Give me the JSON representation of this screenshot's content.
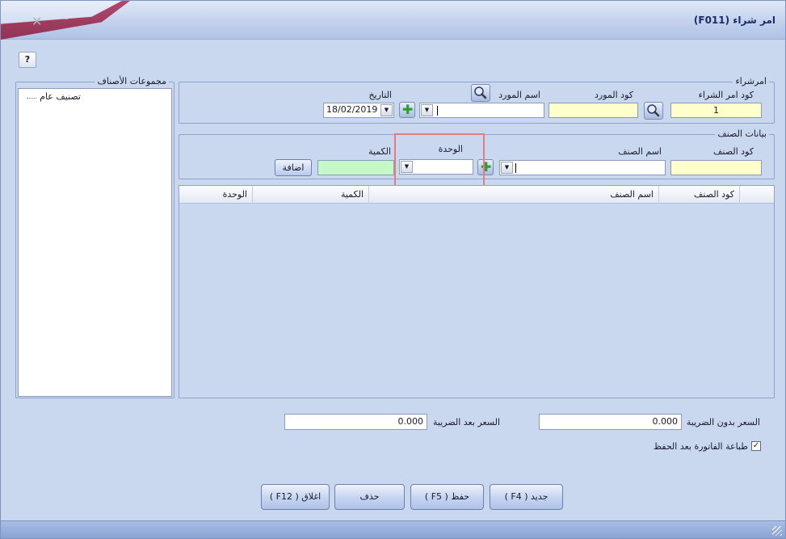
{
  "window": {
    "title": "امر شراء  (F011)"
  },
  "help": {
    "label": "?"
  },
  "purchase_order": {
    "legend": "امرشراء",
    "order_code_label": "كود امر الشراء",
    "order_code_value": "1",
    "supplier_code_label": "كود المورد",
    "supplier_code_value": "",
    "supplier_name_label": "اسم المورد",
    "supplier_name_value": "",
    "date_label": "التاريخ",
    "date_value": "18/02/2019"
  },
  "item_data": {
    "legend": "بيانات الصنف",
    "item_code_label": "كود الصنف",
    "item_code_value": "",
    "item_name_label": "اسم الصنف",
    "item_name_value": "",
    "unit_label": "الوحدة",
    "unit_value": "",
    "quantity_label": "الكمية",
    "quantity_value": "",
    "add_label": "اضافة"
  },
  "categories": {
    "legend": "مجموعات الأصناف",
    "root": "تصنيف عام"
  },
  "grid": {
    "columns": [
      "كود الصنف",
      "اسم الصنف",
      "الكمية",
      "الوحدة"
    ],
    "rows": []
  },
  "totals": {
    "price_before_tax_label": "السعر بدون الضريبة",
    "price_before_tax_value": "0.000",
    "price_after_tax_label": "السعر بعد الضريبة",
    "price_after_tax_value": "0.000",
    "print_after_save_label": "طباعة الفاتورة بعد الحفظ",
    "print_after_save_checked": true
  },
  "buttons": {
    "new": "جديد ( F4 )",
    "save": "حفظ ( F5 )",
    "delete": "حذف",
    "close": "اغلاق ( F12 )"
  },
  "icons": {
    "search": "search-icon",
    "add": "plus-icon",
    "dropdown": "chevron-down-icon"
  },
  "colors": {
    "window_bg": "#c9d7ef",
    "required_field": "#ffffcc",
    "quantity_field": "#c6f7c6",
    "highlight_box": "#e87a84"
  }
}
